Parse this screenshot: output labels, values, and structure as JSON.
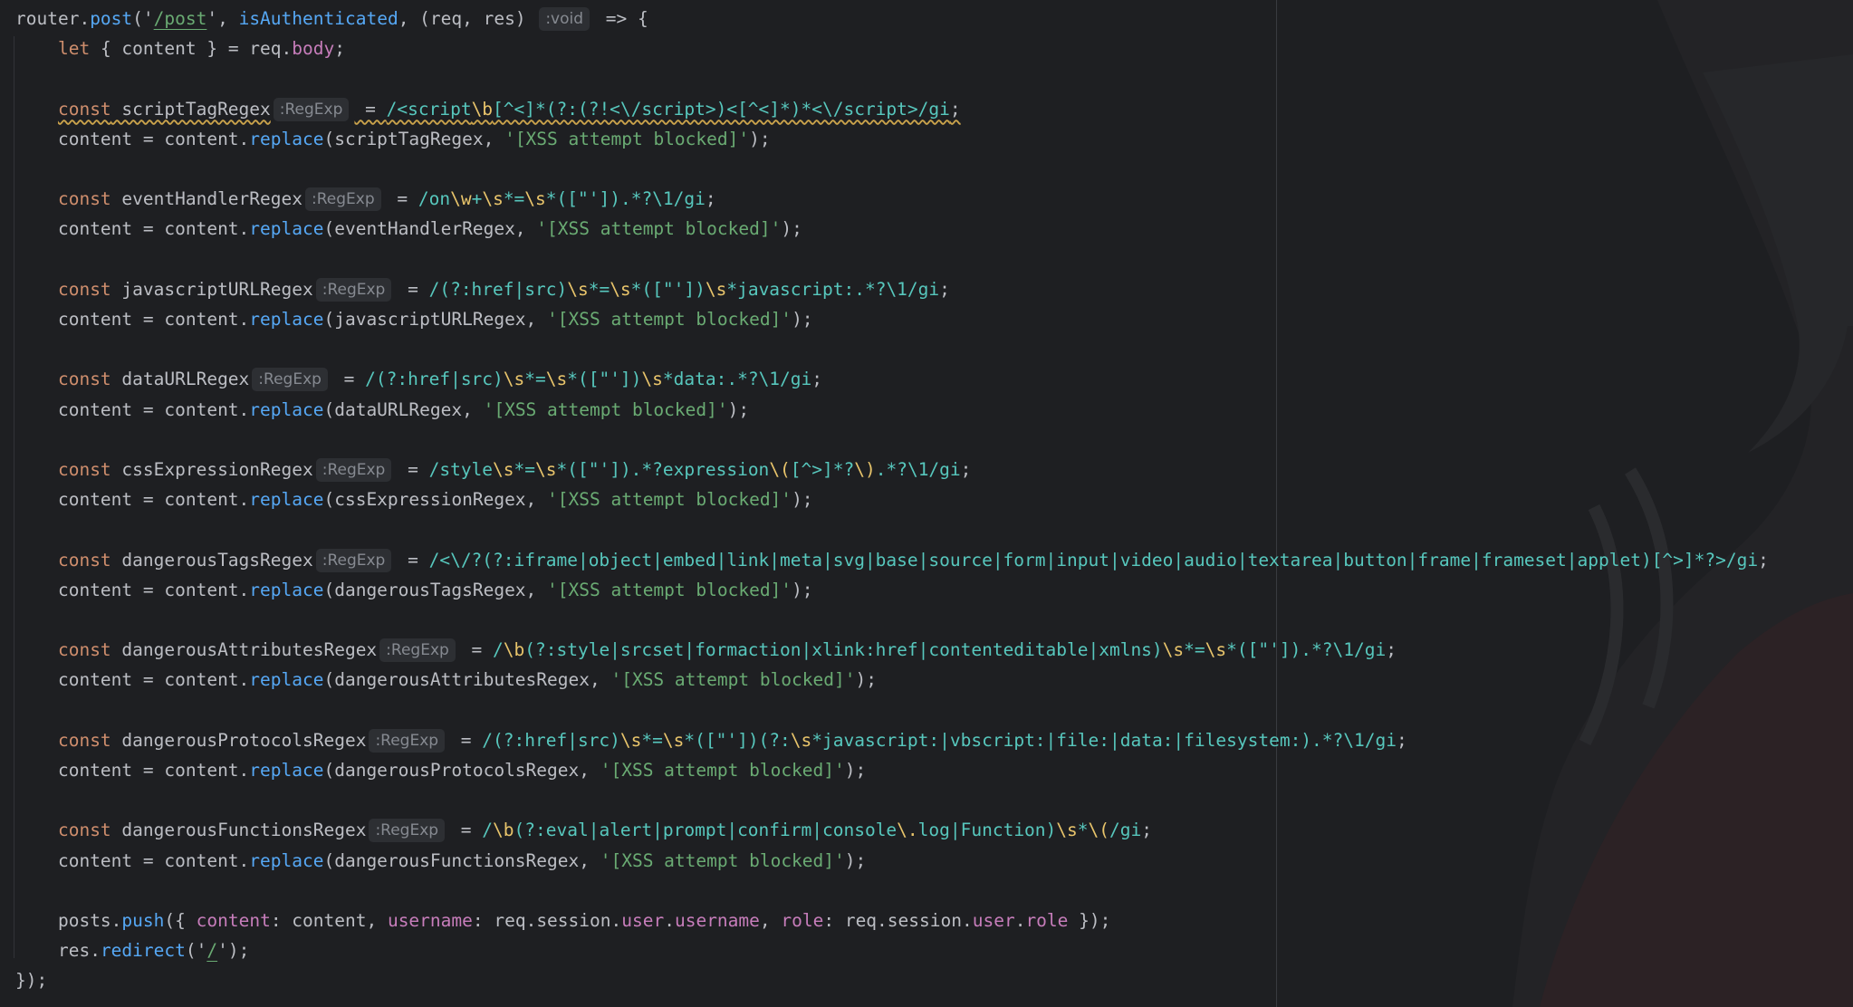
{
  "colors": {
    "background": "#1e1f22",
    "default_text": "#bcbec4",
    "keyword": "#cf8e6d",
    "function_call": "#56a8f5",
    "string": "#6aab73",
    "regex_text": "#57c7bd",
    "regex_escape": "#e8c46b",
    "property": "#c77dbb",
    "inlay_hint": "#868a91"
  },
  "lines": [
    {
      "tokens": [
        [
          "router.",
          "d"
        ],
        [
          "post",
          "f"
        ],
        [
          "('",
          "d"
        ],
        [
          "/post",
          "s",
          "ul"
        ],
        [
          "', ",
          "d"
        ],
        [
          "isAuthenticated",
          "f"
        ],
        [
          ", (req, res) ",
          "d"
        ],
        [
          ":void",
          "h"
        ],
        [
          " => {",
          "d"
        ]
      ]
    },
    {
      "indent": 1,
      "tokens": [
        [
          "let",
          "k"
        ],
        [
          " { content } = req.",
          "d"
        ],
        [
          "body",
          "p"
        ],
        [
          ";",
          "d"
        ]
      ]
    },
    {
      "blank": true
    },
    {
      "indent": 1,
      "tokens": [
        [
          "const",
          "k",
          "sq"
        ],
        [
          " scriptTagRegex",
          "d",
          "sq"
        ],
        [
          ":RegExp",
          "h"
        ],
        [
          " = ",
          "d",
          "sq"
        ],
        [
          "/<script",
          "r",
          "sq"
        ],
        [
          "\\b",
          "e",
          "sq"
        ],
        [
          "[^<]*(?:(?!<\\/script>)<[^<]*)*<\\/script>/gi",
          "r",
          "sq"
        ],
        [
          ";",
          "d",
          "sq"
        ]
      ]
    },
    {
      "indent": 1,
      "tokens": [
        [
          "content = content.",
          "d"
        ],
        [
          "replace",
          "f"
        ],
        [
          "(scriptTagRegex, ",
          "d"
        ],
        [
          "'[XSS attempt blocked]'",
          "s"
        ],
        [
          ");",
          "d"
        ]
      ]
    },
    {
      "blank": true
    },
    {
      "indent": 1,
      "tokens": [
        [
          "const",
          "k"
        ],
        [
          " eventHandlerRegex",
          "d"
        ],
        [
          ":RegExp",
          "h"
        ],
        [
          " = ",
          "d"
        ],
        [
          "/on",
          "r"
        ],
        [
          "\\w",
          "e"
        ],
        [
          "+",
          "r"
        ],
        [
          "\\s",
          "e"
        ],
        [
          "*=",
          "r"
        ],
        [
          "\\s",
          "e"
        ],
        [
          "*([\"']).*?\\1/gi",
          "r"
        ],
        [
          ";",
          "d"
        ]
      ]
    },
    {
      "indent": 1,
      "tokens": [
        [
          "content = content.",
          "d"
        ],
        [
          "replace",
          "f"
        ],
        [
          "(eventHandlerRegex, ",
          "d"
        ],
        [
          "'[XSS attempt blocked]'",
          "s"
        ],
        [
          ");",
          "d"
        ]
      ]
    },
    {
      "blank": true
    },
    {
      "indent": 1,
      "tokens": [
        [
          "const",
          "k"
        ],
        [
          " javascriptURLRegex",
          "d"
        ],
        [
          ":RegExp",
          "h"
        ],
        [
          " = ",
          "d"
        ],
        [
          "/(?:href|src)",
          "r"
        ],
        [
          "\\s",
          "e"
        ],
        [
          "*=",
          "r"
        ],
        [
          "\\s",
          "e"
        ],
        [
          "*([\"'])",
          "r"
        ],
        [
          "\\s",
          "e"
        ],
        [
          "*javascript:.*?\\1/gi",
          "r"
        ],
        [
          ";",
          "d"
        ]
      ]
    },
    {
      "indent": 1,
      "tokens": [
        [
          "content = content.",
          "d"
        ],
        [
          "replace",
          "f"
        ],
        [
          "(javascriptURLRegex, ",
          "d"
        ],
        [
          "'[XSS attempt blocked]'",
          "s"
        ],
        [
          ");",
          "d"
        ]
      ]
    },
    {
      "blank": true
    },
    {
      "indent": 1,
      "tokens": [
        [
          "const",
          "k"
        ],
        [
          " dataURLRegex",
          "d"
        ],
        [
          ":RegExp",
          "h"
        ],
        [
          " = ",
          "d"
        ],
        [
          "/(?:href|src)",
          "r"
        ],
        [
          "\\s",
          "e"
        ],
        [
          "*=",
          "r"
        ],
        [
          "\\s",
          "e"
        ],
        [
          "*([\"'])",
          "r"
        ],
        [
          "\\s",
          "e"
        ],
        [
          "*data:.*?\\1/gi",
          "r"
        ],
        [
          ";",
          "d"
        ]
      ]
    },
    {
      "indent": 1,
      "tokens": [
        [
          "content = content.",
          "d"
        ],
        [
          "replace",
          "f"
        ],
        [
          "(dataURLRegex, ",
          "d"
        ],
        [
          "'[XSS attempt blocked]'",
          "s"
        ],
        [
          ");",
          "d"
        ]
      ]
    },
    {
      "blank": true
    },
    {
      "indent": 1,
      "tokens": [
        [
          "const",
          "k"
        ],
        [
          " cssExpressionRegex",
          "d"
        ],
        [
          ":RegExp",
          "h"
        ],
        [
          " = ",
          "d"
        ],
        [
          "/style",
          "r"
        ],
        [
          "\\s",
          "e"
        ],
        [
          "*=",
          "r"
        ],
        [
          "\\s",
          "e"
        ],
        [
          "*([\"']).*?expression",
          "r"
        ],
        [
          "\\(",
          "e"
        ],
        [
          "[^>]*?",
          "r"
        ],
        [
          "\\)",
          "e"
        ],
        [
          ".*?\\1/gi",
          "r"
        ],
        [
          ";",
          "d"
        ]
      ]
    },
    {
      "indent": 1,
      "tokens": [
        [
          "content = content.",
          "d"
        ],
        [
          "replace",
          "f"
        ],
        [
          "(cssExpressionRegex, ",
          "d"
        ],
        [
          "'[XSS attempt blocked]'",
          "s"
        ],
        [
          ");",
          "d"
        ]
      ]
    },
    {
      "blank": true
    },
    {
      "indent": 1,
      "tokens": [
        [
          "const",
          "k"
        ],
        [
          " dangerousTagsRegex",
          "d"
        ],
        [
          ":RegExp",
          "h"
        ],
        [
          " = ",
          "d"
        ],
        [
          "/<\\/?(?:iframe|object|embed|link|meta|svg|base|source|form|input|video|audio|textarea|button|frame|frameset|applet)[^>]*?>/gi",
          "r"
        ],
        [
          ";",
          "d"
        ]
      ]
    },
    {
      "indent": 1,
      "tokens": [
        [
          "content = content.",
          "d"
        ],
        [
          "replace",
          "f"
        ],
        [
          "(dangerousTagsRegex, ",
          "d"
        ],
        [
          "'[XSS attempt blocked]'",
          "s"
        ],
        [
          ");",
          "d"
        ]
      ]
    },
    {
      "blank": true
    },
    {
      "indent": 1,
      "tokens": [
        [
          "const",
          "k"
        ],
        [
          " dangerousAttributesRegex",
          "d"
        ],
        [
          ":RegExp",
          "h"
        ],
        [
          " = ",
          "d"
        ],
        [
          "/",
          "r"
        ],
        [
          "\\b",
          "e"
        ],
        [
          "(?:style|srcset|formaction|xlink:href|contenteditable|xmlns)",
          "r"
        ],
        [
          "\\s",
          "e"
        ],
        [
          "*=",
          "r"
        ],
        [
          "\\s",
          "e"
        ],
        [
          "*([\"']).*?\\1/gi",
          "r"
        ],
        [
          ";",
          "d"
        ]
      ]
    },
    {
      "indent": 1,
      "tokens": [
        [
          "content = content.",
          "d"
        ],
        [
          "replace",
          "f"
        ],
        [
          "(dangerousAttributesRegex, ",
          "d"
        ],
        [
          "'[XSS attempt blocked]'",
          "s"
        ],
        [
          ");",
          "d"
        ]
      ]
    },
    {
      "blank": true
    },
    {
      "indent": 1,
      "tokens": [
        [
          "const",
          "k"
        ],
        [
          " dangerousProtocolsRegex",
          "d"
        ],
        [
          ":RegExp",
          "h"
        ],
        [
          " = ",
          "d"
        ],
        [
          "/(?:href|src)",
          "r"
        ],
        [
          "\\s",
          "e"
        ],
        [
          "*=",
          "r"
        ],
        [
          "\\s",
          "e"
        ],
        [
          "*([\"'])(?:",
          "r"
        ],
        [
          "\\s",
          "e"
        ],
        [
          "*javascript:|vbscript:|file:|data:|filesystem:).*?\\1/gi",
          "r"
        ],
        [
          ";",
          "d"
        ]
      ]
    },
    {
      "indent": 1,
      "tokens": [
        [
          "content = content.",
          "d"
        ],
        [
          "replace",
          "f"
        ],
        [
          "(dangerousProtocolsRegex, ",
          "d"
        ],
        [
          "'[XSS attempt blocked]'",
          "s"
        ],
        [
          ");",
          "d"
        ]
      ]
    },
    {
      "blank": true
    },
    {
      "indent": 1,
      "tokens": [
        [
          "const",
          "k"
        ],
        [
          " dangerousFunctionsRegex",
          "d"
        ],
        [
          ":RegExp",
          "h"
        ],
        [
          " = ",
          "d"
        ],
        [
          "/",
          "r"
        ],
        [
          "\\b",
          "e"
        ],
        [
          "(?:eval|alert|prompt|confirm|console",
          "r"
        ],
        [
          "\\.",
          "e"
        ],
        [
          "log|Function)",
          "r"
        ],
        [
          "\\s",
          "e"
        ],
        [
          "*",
          "r"
        ],
        [
          "\\(",
          "e"
        ],
        [
          "/gi",
          "r"
        ],
        [
          ";",
          "d"
        ]
      ]
    },
    {
      "indent": 1,
      "tokens": [
        [
          "content = content.",
          "d"
        ],
        [
          "replace",
          "f"
        ],
        [
          "(dangerousFunctionsRegex, ",
          "d"
        ],
        [
          "'[XSS attempt blocked]'",
          "s"
        ],
        [
          ");",
          "d"
        ]
      ]
    },
    {
      "blank": true
    },
    {
      "indent": 1,
      "tokens": [
        [
          "posts.",
          "d"
        ],
        [
          "push",
          "f"
        ],
        [
          "({ ",
          "d"
        ],
        [
          "content",
          "p"
        ],
        [
          ": content, ",
          "d"
        ],
        [
          "username",
          "p"
        ],
        [
          ": req.session.",
          "d"
        ],
        [
          "user",
          "p"
        ],
        [
          ".",
          "d"
        ],
        [
          "username",
          "p"
        ],
        [
          ", ",
          "d"
        ],
        [
          "role",
          "p"
        ],
        [
          ": req.session.",
          "d"
        ],
        [
          "user",
          "p"
        ],
        [
          ".",
          "d"
        ],
        [
          "role",
          "p"
        ],
        [
          " });",
          "d"
        ]
      ]
    },
    {
      "indent": 1,
      "tokens": [
        [
          "res.",
          "d"
        ],
        [
          "redirect",
          "f"
        ],
        [
          "('",
          "d"
        ],
        [
          "/",
          "s",
          "ul"
        ],
        [
          "');",
          "d"
        ]
      ]
    },
    {
      "tokens": [
        [
          "});",
          "d"
        ]
      ]
    }
  ]
}
